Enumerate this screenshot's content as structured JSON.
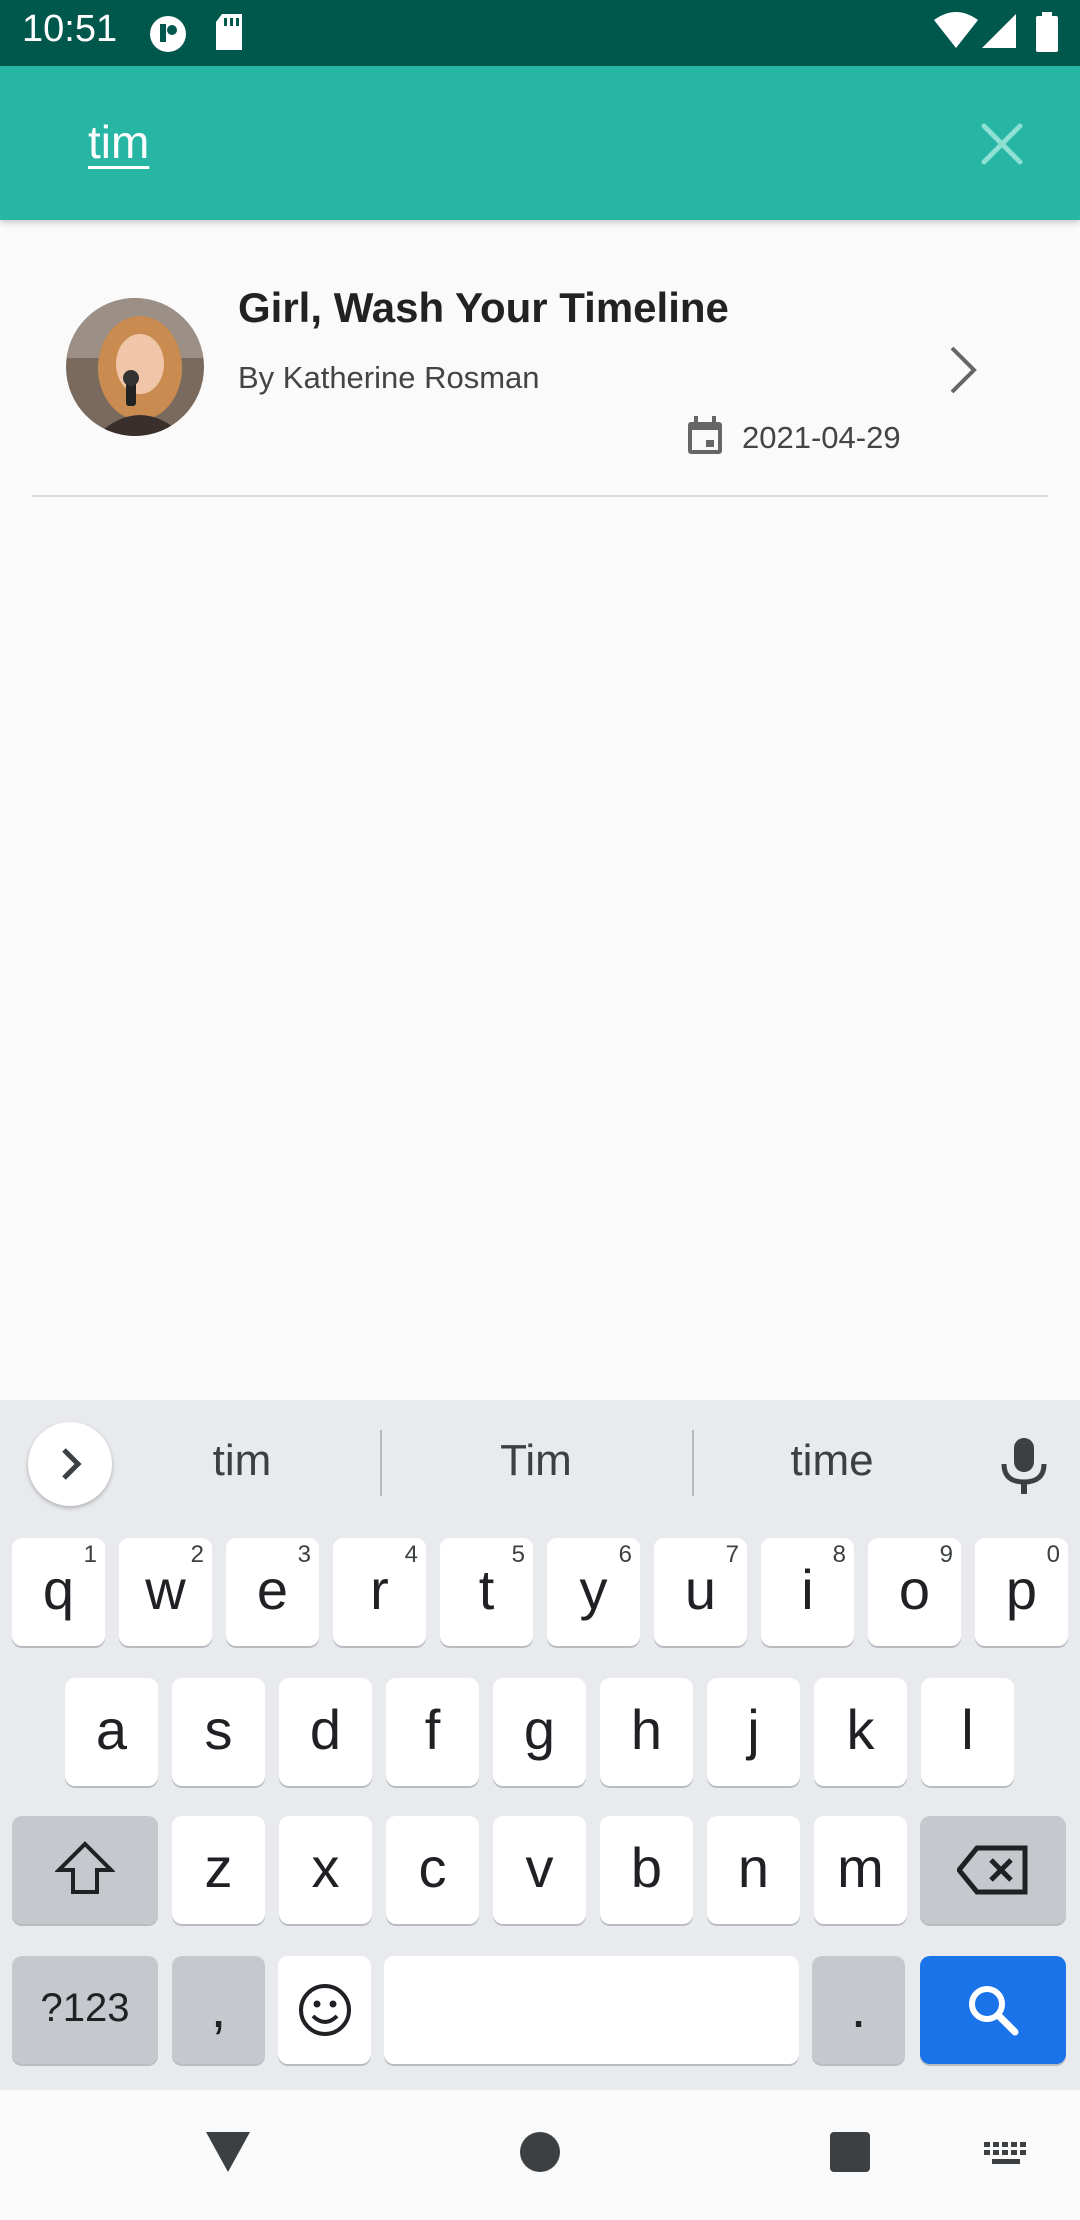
{
  "status": {
    "time": "10:51"
  },
  "search": {
    "query": "tim"
  },
  "results": [
    {
      "title": "Girl, Wash Your Timeline",
      "author": "By Katherine Rosman",
      "date": "2021-04-29"
    }
  ],
  "keyboard": {
    "suggestions": [
      "tim",
      "Tim",
      "time"
    ],
    "row1": [
      {
        "k": "q",
        "h": "1"
      },
      {
        "k": "w",
        "h": "2"
      },
      {
        "k": "e",
        "h": "3"
      },
      {
        "k": "r",
        "h": "4"
      },
      {
        "k": "t",
        "h": "5"
      },
      {
        "k": "y",
        "h": "6"
      },
      {
        "k": "u",
        "h": "7"
      },
      {
        "k": "i",
        "h": "8"
      },
      {
        "k": "o",
        "h": "9"
      },
      {
        "k": "p",
        "h": "0"
      }
    ],
    "row2": [
      "a",
      "s",
      "d",
      "f",
      "g",
      "h",
      "j",
      "k",
      "l"
    ],
    "row3": [
      "z",
      "x",
      "c",
      "v",
      "b",
      "n",
      "m"
    ],
    "symbols_label": "?123",
    "comma_label": ",",
    "period_label": "."
  },
  "colors": {
    "status_bar": "#00574b",
    "toolbar": "#26b6a3",
    "search_key": "#1a73e8"
  }
}
